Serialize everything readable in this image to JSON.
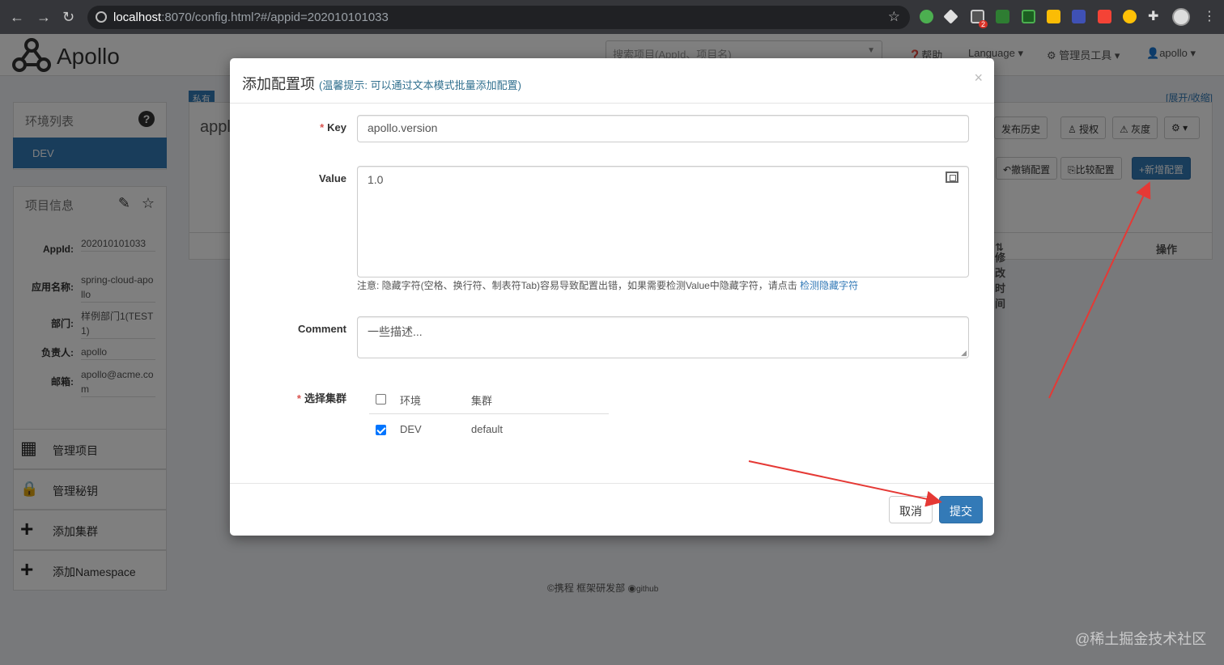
{
  "browser": {
    "url_host": "localhost",
    "url_path": ":8070/config.html?#/appid=202010101033",
    "ext_badge": "2"
  },
  "topnav": {
    "logo": "Apollo",
    "search_placeholder": "搜索项目(AppId、项目名)",
    "help": "帮助",
    "language": "Language",
    "admin_tools": "管理员工具",
    "user": "apollo"
  },
  "sidebar": {
    "env_title": "环境列表",
    "env_selected": "DEV",
    "info_title": "项目信息",
    "info": [
      {
        "label": "AppId:",
        "value": "202010101033"
      },
      {
        "label": "应用名称:",
        "value": "spring-cloud-apollo"
      },
      {
        "label": "部门:",
        "value": "样例部门1(TEST1)"
      },
      {
        "label": "负责人:",
        "value": "apollo"
      },
      {
        "label": "邮箱:",
        "value": "apollo@acme.com"
      }
    ],
    "actions": [
      {
        "icon": "▦",
        "label": "管理项目"
      },
      {
        "icon": "🔒",
        "label": "管理秘钥"
      },
      {
        "icon": "+",
        "label": "添加集群"
      },
      {
        "icon": "+",
        "label": "添加Namespace"
      }
    ]
  },
  "main": {
    "badge": "私有",
    "app_title": "appl",
    "expand": "[展开/收缩]",
    "toolbar": {
      "history": "发布历史",
      "grant": "授权",
      "gray": "灰度",
      "revoke": "撤销配置",
      "compare": "比较配置",
      "add": "新增配置"
    },
    "columns": {
      "modified": "修改时间",
      "ops": "操作"
    }
  },
  "modal": {
    "title": "添加配置项",
    "tip": "(温馨提示: 可以通过文本模式批量添加配置)",
    "close": "×",
    "key_label": "Key",
    "key_value": "apollo.version",
    "value_label": "Value",
    "value_value": "1.0",
    "hint_text": "注意: 隐藏字符(空格、换行符、制表符Tab)容易导致配置出错，如果需要检测Value中隐藏字符，请点击",
    "hint_link": "检测隐藏字符",
    "comment_label": "Comment",
    "comment_placeholder": "一些描述...",
    "cluster_label": "选择集群",
    "cluster_header": {
      "env": "环境",
      "cluster": "集群",
      "checked": false
    },
    "cluster_rows": [
      {
        "env": "DEV",
        "cluster": "default",
        "checked": true
      }
    ],
    "cancel": "取消",
    "submit": "提交"
  },
  "footer": {
    "text": "©携程 框架研发部",
    "github": "github"
  },
  "watermark": "@稀土掘金技术社区",
  "colors": {
    "primary": "#337ab7",
    "arrow": "#e53935",
    "required": "#d9534f"
  }
}
